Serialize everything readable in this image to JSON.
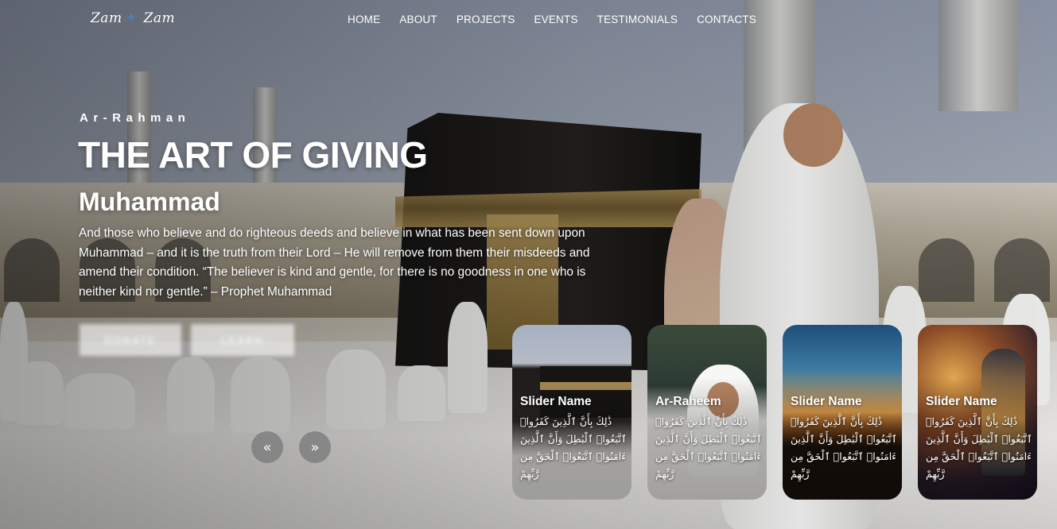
{
  "brand": {
    "logo_left": "Zam",
    "logo_right": "Zam",
    "logo_icon": "paper-plane-icon"
  },
  "nav": {
    "items": [
      "HOME",
      "ABOUT",
      "PROJECTS",
      "EVENTS",
      "TESTIMONIALS",
      "CONTACTS"
    ]
  },
  "hero": {
    "eyebrow": "Ar-Rahman",
    "title": "THE ART OF GIVING",
    "subtitle": "Muhammad",
    "description": "And those who believe and do righteous deeds and believe in what has been sent down upon Muhammad – and it is the truth from their Lord – He will remove from them their misdeeds and amend their condition. “The believer is kind and gentle, for there is no goodness in one who is neither kind nor gentle.” – Prophet Muhammad",
    "buttons": [
      "DONATE",
      "LEARN"
    ]
  },
  "slider": {
    "prev_icon": "«",
    "next_icon": "»",
    "cards": [
      {
        "name": "Slider Name",
        "text": "ذَٰلِكَ بِأَنَّ ٱلَّذِينَ كَفَرُوا۟ ٱتَّبَعُوا۟ ٱلْبَٰطِلَ وَأَنَّ ٱلَّذِينَ ءَامَنُوا۟ ٱتَّبَعُوا۟ ٱلْحَقَّ مِن رَّبِّهِمْ"
      },
      {
        "name": "Ar-Raheem",
        "text": "ذَٰلِكَ بِأَنَّ ٱلَّذِينَ كَفَرُوا۟ ٱتَّبَعُوا۟ ٱلْبَٰطِلَ وَأَنَّ ٱلَّذِينَ ءَامَنُوا۟ ٱتَّبَعُوا۟ ٱلْحَقَّ مِن رَّبِّهِمْ"
      },
      {
        "name": "Slider Name",
        "text": "ذَٰلِكَ بِأَنَّ ٱلَّذِينَ كَفَرُوا۟ ٱتَّبَعُوا۟ ٱلْبَٰطِلَ وَأَنَّ ٱلَّذِينَ ءَامَنُوا۟ ٱتَّبَعُوا۟ ٱلْحَقَّ مِن رَّبِّهِمْ"
      },
      {
        "name": "Slider Name",
        "text": "ذَٰلِكَ بِأَنَّ ٱلَّذِينَ كَفَرُوا۟ ٱتَّبَعُوا۟ ٱلْبَٰطِلَ وَأَنَّ ٱلَّذِينَ ءَامَنُوا۟ ٱتَّبَعُوا۟ ٱلْحَقَّ مِن رَّبِّهِمْ"
      }
    ]
  },
  "colors": {
    "logo_icon": "#3b8fd9",
    "arrow_bg": "#787878"
  }
}
